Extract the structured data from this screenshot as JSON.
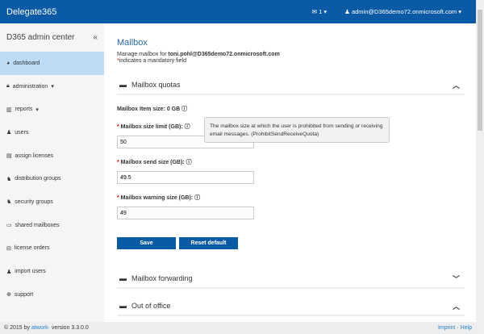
{
  "header": {
    "brand": "Delegate365",
    "messages_count": "1",
    "user": "admin@D365demo72.onmicrosoft.com"
  },
  "sidebar": {
    "title": "D365 admin center",
    "collapse": "«",
    "items": [
      {
        "label": "dashboard",
        "icon": "dashboard-icon"
      },
      {
        "label": "administration",
        "icon": "lock-icon",
        "dropdown": true
      },
      {
        "label": "reports",
        "icon": "chart-icon",
        "dropdown": true
      },
      {
        "label": "users",
        "icon": "user-icon"
      },
      {
        "label": "assign licenses",
        "icon": "file-icon"
      },
      {
        "label": "distribution groups",
        "icon": "users-icon"
      },
      {
        "label": "security groups",
        "icon": "users-icon"
      },
      {
        "label": "shared mailboxes",
        "icon": "inbox-icon"
      },
      {
        "label": "license orders",
        "icon": "cart-icon"
      },
      {
        "label": "import users",
        "icon": "user-icon"
      },
      {
        "label": "support",
        "icon": "lifebuoy-icon"
      }
    ]
  },
  "main": {
    "title": "Mailbox",
    "manage_prefix": "Manage mailbox for ",
    "mailbox": "toni.pohl@D365demo72.onmicrosoft.com",
    "mandatory": "indicates a mandatory field",
    "asterisk": "*",
    "quotas": {
      "title": "Mailbox quotas",
      "item_size": "Mailbox Item size: 0 GB",
      "size_limit_label": "Mailbox size limit (GB):",
      "size_limit": "50",
      "send_label": "Mailbox send size (GB):",
      "send": "49.5",
      "warning_label": "Mailbox warning size (GB):",
      "warning": "49",
      "save": "Save",
      "reset": "Reset default"
    },
    "tooltip": "The mailbox size at which the user is prohibited from sending or receiving email messages. (ProhibitSendReceiveQuota)",
    "forwarding": "Mailbox forwarding",
    "ooo": "Out of office"
  },
  "footer": {
    "copy": "© 2015 by ",
    "company": "atwork",
    "version": " · version 3.3.0.0",
    "imprint": "Imprint",
    "help": "Help"
  }
}
